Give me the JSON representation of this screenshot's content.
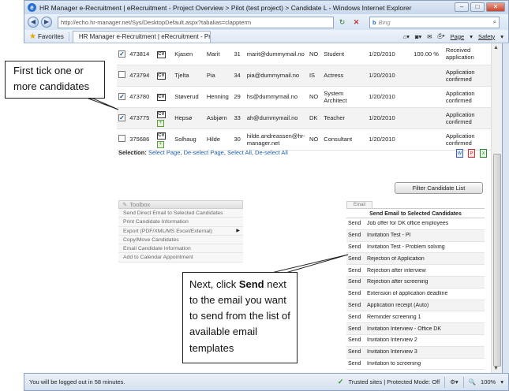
{
  "window": {
    "title": "HR Manager e-Recruitment | eRecruitment - Project Overview > Pilot (test project) > Candidate L - Windows Internet Explorer"
  },
  "address": {
    "url": "http://echo.hr-manager.net/Sys/DesktopDefault.aspx?tabalias=clappterm",
    "url_host": "hr-manager.net",
    "search_placeholder": "Bing",
    "search_brand": "b"
  },
  "favorites": {
    "label": "Favorites",
    "tab_title": "HR Manager e-Recruitment | eRecruitment - Proj...",
    "page_menu": "Page",
    "safety_menu": "Safety"
  },
  "candidates": [
    {
      "checked": true,
      "id": "473814",
      "last": "Kjasen",
      "first": "Marit",
      "age": "31",
      "email": "marit@dummymail.no",
      "country": "NO",
      "position": "Student",
      "date": "1/20/2010",
      "score": "100.00 %",
      "status": "Received application"
    },
    {
      "checked": false,
      "id": "473794",
      "last": "Tjelta",
      "first": "Pia",
      "age": "34",
      "email": "pia@dummymail.no",
      "country": "IS",
      "position": "Actress",
      "date": "1/20/2010",
      "score": "",
      "status": "Application confirmed"
    },
    {
      "checked": true,
      "id": "473780",
      "last": "Støverud",
      "first": "Henning",
      "age": "29",
      "email": "hs@dummymail.no",
      "country": "NO",
      "position": "System Architect",
      "date": "1/20/2010",
      "score": "",
      "status": "Application confirmed"
    },
    {
      "checked": true,
      "id": "473775",
      "last": "Hepsø",
      "first": "Asbjørn",
      "age": "33",
      "email": "ah@dummymail.no",
      "country": "DK",
      "position": "Teacher",
      "date": "1/20/2010",
      "score": "",
      "status": "Application confirmed"
    },
    {
      "checked": false,
      "id": "375686",
      "last": "Solhaug",
      "first": "Hilde",
      "age": "30",
      "email": "hilde.andreassen@hr-manager.net",
      "country": "NO",
      "position": "Consultant",
      "date": "1/20/2010",
      "score": "",
      "status": "Application confirmed"
    }
  ],
  "selection": {
    "label": "Selection:",
    "select_page": "Select Page",
    "deselect_page": "De-select Page",
    "select_all": "Select All",
    "deselect_all": "De-select All"
  },
  "filter_button": "Filter Candidate List",
  "toolbox": {
    "title": "Toolbox",
    "items": [
      "Send Direct Email to Selected Candidates",
      "Print Candidate Information",
      "Export (PDF/XML/MS Excel/External)",
      "Copy/Move Candidates",
      "Email Candidate Information",
      "Add to Calendar Appointment"
    ]
  },
  "email": {
    "tab": "Email",
    "heading": "Send Email to Selected Candidates",
    "send_label": "Send",
    "templates": [
      "Job offer for DK office employees",
      "Invitation Test - PI",
      "Invitation Test - Problem solving",
      "Rejection of Application",
      "Rejection after interview",
      "Rejection after screening",
      "Extension of application deadline",
      "Application receipt (Auto)",
      "Reminder screening 1",
      "Invitation Interview - Office DK",
      "Invitation Interview 2",
      "Invitation Interview 3",
      "Invitation to screening"
    ]
  },
  "callouts": {
    "first": "First tick one or more candidates",
    "second_pre": "Next, click ",
    "second_bold": "Send",
    "second_post": " next to the email you want to send from the list of available email templates"
  },
  "status": {
    "text": "You will be logged out in 58 minutes.",
    "zone": "Trusted sites | Protected Mode: Off",
    "zoom": "100%"
  }
}
